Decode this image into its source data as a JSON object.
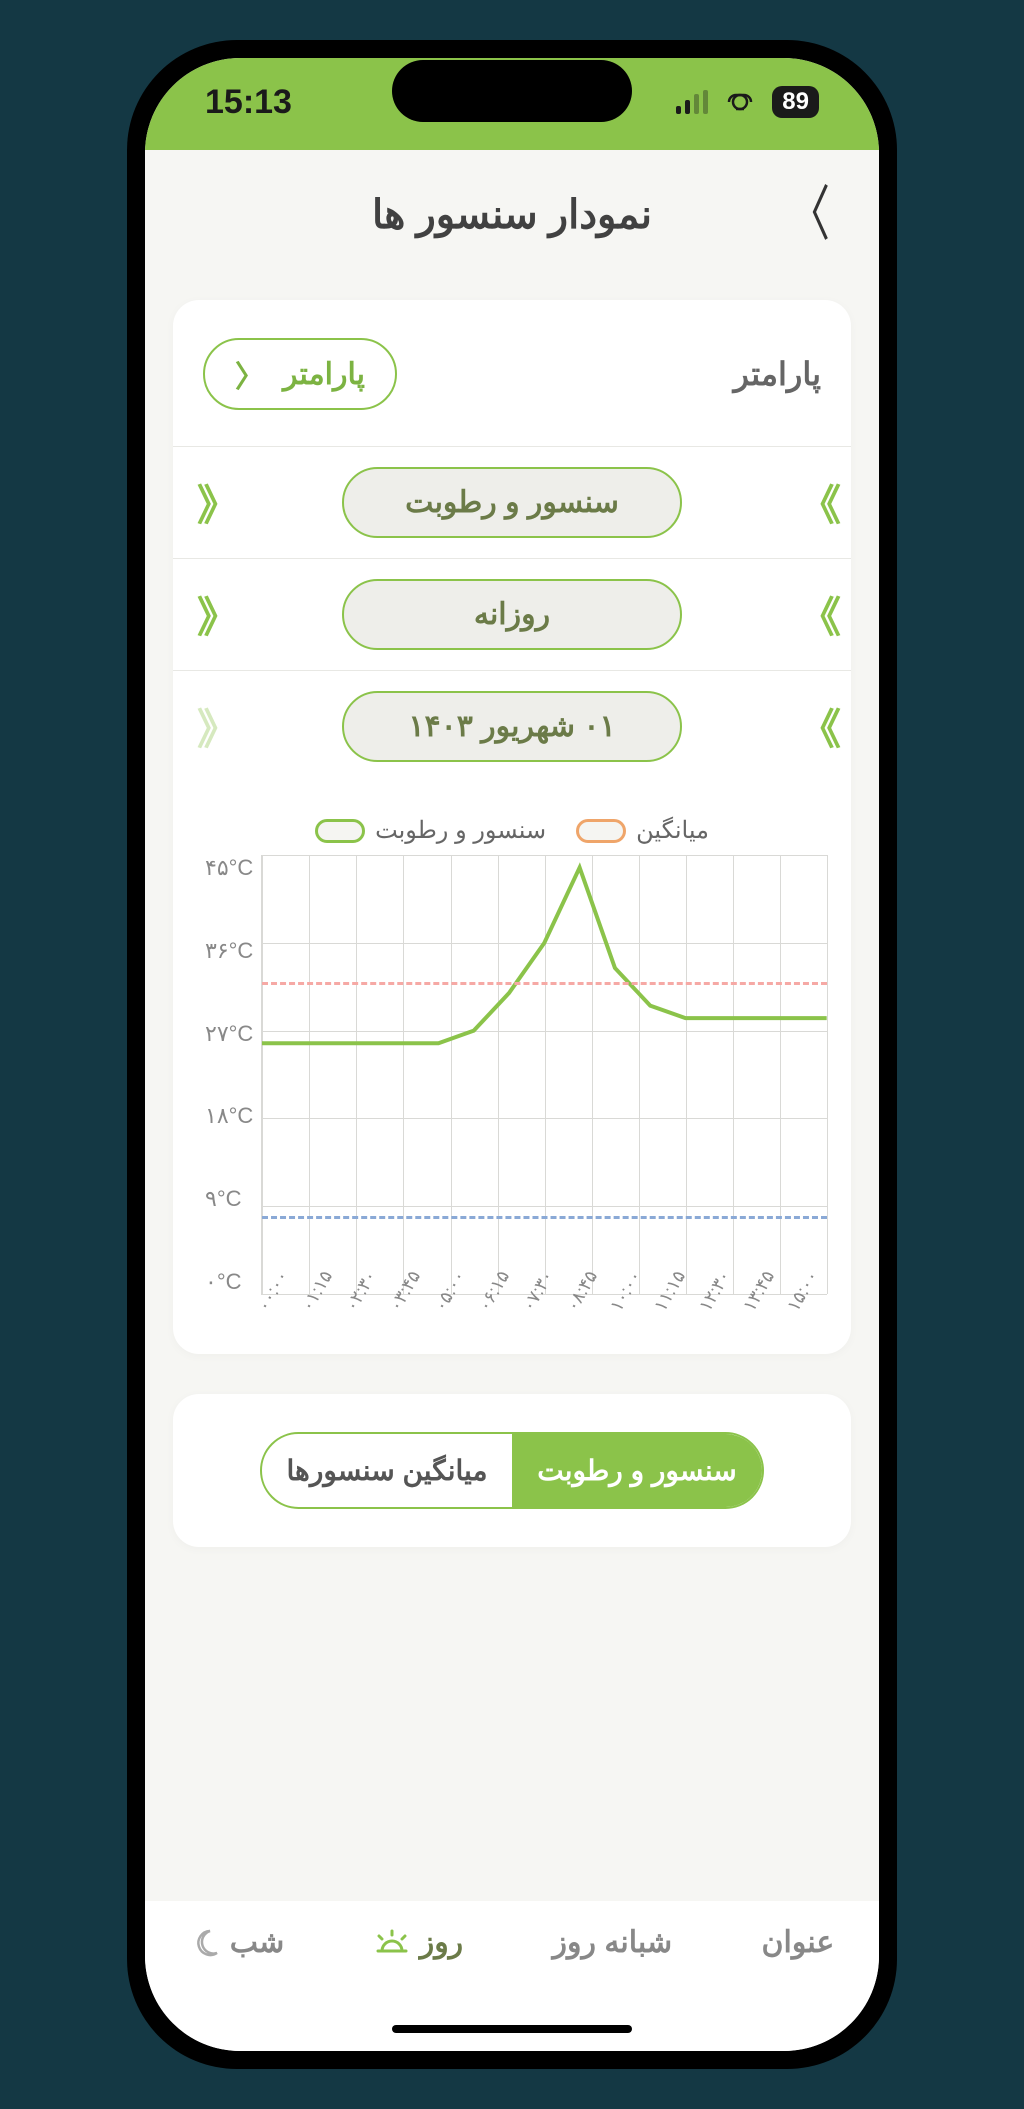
{
  "status": {
    "time": "15:13",
    "battery": "89"
  },
  "header": {
    "title": "نمودار سنسور ها"
  },
  "param": {
    "label": "پارامتر",
    "button": "پارامتر"
  },
  "selectors": {
    "sensor": "سنسور و رطوبت",
    "period": "روزانه",
    "date": "۰۱ شهریور ۱۴۰۳"
  },
  "legend": {
    "series": "سنسور و رطوبت",
    "avg": "میانگین"
  },
  "toggle": {
    "active": "سنسور و رطوبت",
    "inactive": "میانگین سنسورها"
  },
  "bottom": {
    "title": "عنوان",
    "dayNight": "شبانه روز",
    "day": "روز",
    "night": "شب"
  },
  "chart_data": {
    "type": "line",
    "title": "",
    "xlabel": "",
    "ylabel": "°C",
    "ylim": [
      0,
      45
    ],
    "y_ticks": [
      "۴۵°C",
      "۳۶°C",
      "۲۷°C",
      "۱۸°C",
      "۹°C",
      "۰°C"
    ],
    "x_ticks": [
      "۰۰:۰۰",
      "۰۱:۱۵",
      "۰۲:۳۰",
      "۰۳:۴۵",
      "۰۵:۰۰",
      "۰۶:۱۵",
      "۰۷:۳۰",
      "۰۸:۴۵",
      "۱۰:۰۰",
      "۱۱:۱۵",
      "۱۲:۳۰",
      "۱۳:۴۵",
      "۱۵:۰۰"
    ],
    "reference_lines": [
      {
        "name": "upper",
        "value": 32,
        "color": "#f6a9a5"
      },
      {
        "name": "lower",
        "value": 8,
        "color": "#8aa9d6"
      }
    ],
    "series": [
      {
        "name": "سنسور و رطوبت",
        "color": "#8BC34A",
        "x": [
          "00:00",
          "01:15",
          "02:30",
          "03:45",
          "05:00",
          "06:15",
          "07:30",
          "08:00",
          "08:20",
          "08:45",
          "09:10",
          "09:30",
          "10:00",
          "11:15",
          "12:30",
          "13:45",
          "15:00"
        ],
        "values": [
          30,
          30,
          30,
          30,
          30,
          30,
          31,
          34,
          38,
          44,
          36,
          33,
          32,
          32,
          32,
          32,
          32
        ]
      }
    ]
  }
}
